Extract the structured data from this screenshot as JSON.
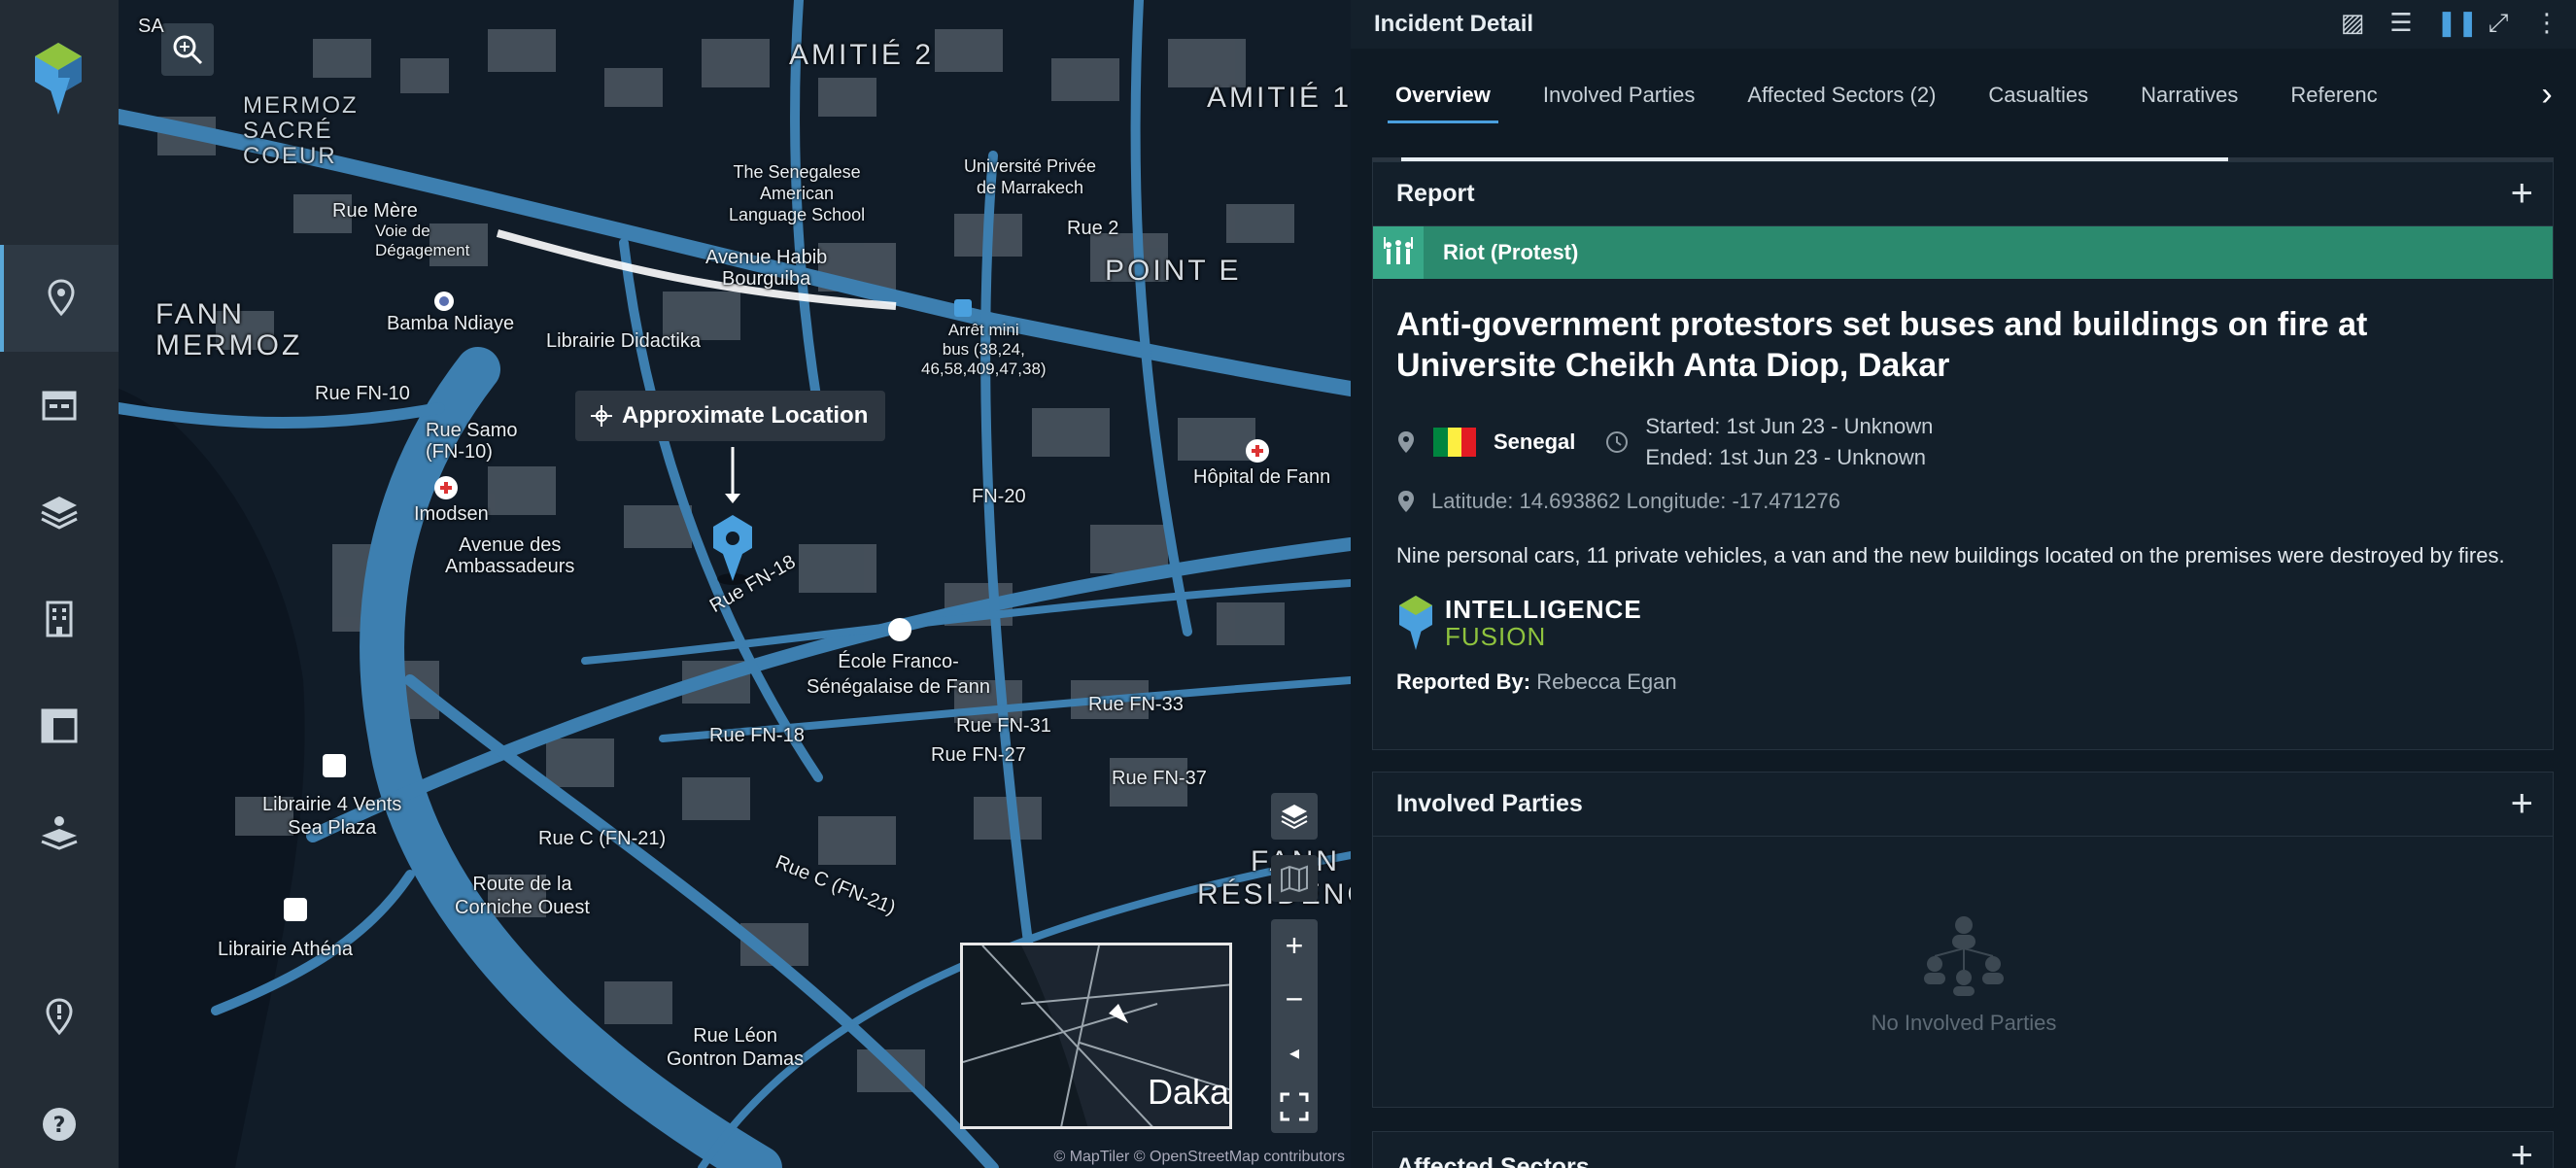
{
  "sidebar": {
    "logo": "intelligence-fusion-logo",
    "items": [
      {
        "name": "location-pin-icon",
        "active": true
      },
      {
        "name": "calendar-icon",
        "active": false
      },
      {
        "name": "layers-icon",
        "active": false
      },
      {
        "name": "building-icon",
        "active": false
      },
      {
        "name": "dashboard-icon",
        "active": false
      },
      {
        "name": "stacked-layers-pin-icon",
        "active": false
      },
      {
        "name": "alert-pin-icon",
        "active": false
      },
      {
        "name": "help-icon",
        "active": false
      }
    ]
  },
  "map": {
    "tooltip": "Approximate Location",
    "attribution": "© MapTiler © OpenStreetMap contributors",
    "minimap_label": "Daka",
    "labels": {
      "fann_mermoz": "FANN\nMERMOZ",
      "mermoz_sacre_coeur": "MERMOZ\nSACRÉ\nCOEUR",
      "amitie2": "AMITIÉ 2",
      "amitie1": "AMITIÉ 1",
      "point_e": "POINT E",
      "fann_residence": "FANN\nRÉSIDENCE",
      "sa": "SA",
      "bamba": "Bamba Ndiaye",
      "librairie_didactika": "Librairie Didactika",
      "rue_fn10": "Rue FN-10",
      "rue_samo": "Rue Samo\n(FN-10)",
      "imodsen": "Imodsen",
      "avenue_ambassadeurs": "Avenue des\nAmbassadeurs",
      "avenue_habib": "Avenue Habib\nBourguiba",
      "arret_mini_bus": "Arrêt mini\nbus (38,24,\n46,58,409,47,38)",
      "senegalese_american": "The Senegalese\nAmerican\nLanguage School",
      "universite_privee": "Université Privée\nde Marrakech",
      "hopital_fann": "Hôpital de Fann",
      "ecole_franco": "École Franco-\nSénégalaise de Fann",
      "rue_fn18": "Rue FN-18",
      "rue_fn31": "Rue FN-31",
      "rue_fn27": "Rue FN-27",
      "rue_fn33": "Rue FN-33",
      "rue_fn37": "Rue FN-37",
      "rue_fn20": "FN-20",
      "rue_c_fn21": "Rue C (FN-21)",
      "rue_c_fn21b": "Rue C (FN-21)",
      "librairie_4vents": "Librairie 4 Vents\nSea Plaza",
      "route_corniche": "Route de la\nCorniche Ouest",
      "librairie_athena": "Librairie Athéna",
      "rue_leon": "Rue Léon\nGontron Damas",
      "rue_fn2": "Rue 2",
      "rue_mere": "Rue Mère",
      "voie_rue": "Voie de\nDégagement"
    }
  },
  "panel": {
    "title": "Incident Detail",
    "header_icons": [
      "image-icon",
      "rows-icon",
      "columns-icon",
      "expand-icon",
      "more-icon"
    ],
    "tabs": [
      "Overview",
      "Involved Parties",
      "Affected Sectors (2)",
      "Casualties",
      "Narratives",
      "Referenc"
    ],
    "active_tab": "Overview",
    "report": {
      "section_title": "Report",
      "category": "Riot (Protest)",
      "category_color": "#2b8a6e",
      "headline": "Anti-government protestors set buses and buildings on fire at Universite Cheikh Anta Diop, Dakar",
      "country": "Senegal",
      "started": "Started: 1st Jun 23 - Unknown",
      "ended": "Ended: 1st Jun 23 - Unknown",
      "coordinates": "Latitude: 14.693862 Longitude: -17.471276",
      "description": "Nine personal cars, 11 private vehicles, a van and the new buildings located on the premises were destroyed by fires.",
      "source_line1": "INTELLIGENCE",
      "source_line2": "FUSION",
      "reported_by_label": "Reported By:",
      "reported_by_value": "Rebecca Egan"
    },
    "involved_parties": {
      "section_title": "Involved Parties",
      "empty_text": "No Involved Parties"
    },
    "affected_sectors": {
      "section_title": "Affected Sectors"
    }
  }
}
